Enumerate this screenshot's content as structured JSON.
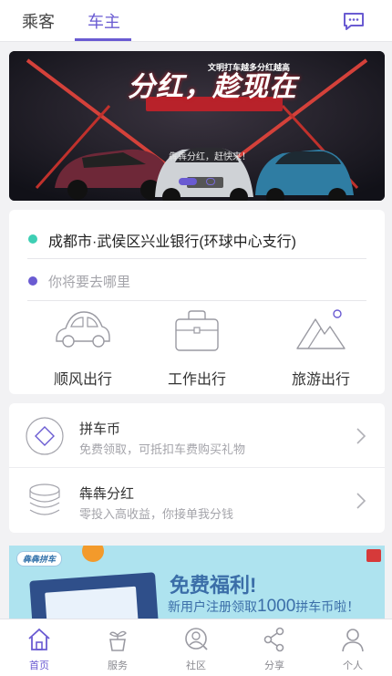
{
  "header": {
    "tabs": [
      {
        "label": "乘客",
        "active": false
      },
      {
        "label": "车主",
        "active": true
      }
    ],
    "message_icon": "chat-bubble-icon"
  },
  "banner": {
    "title": "分红，趁现在",
    "subtitle": "文明打车越多分红越高",
    "slogan": "犇犇分红，赶快来！",
    "carousel_index": 1,
    "carousel_count": 2
  },
  "route": {
    "from": "成都市·武侯区兴业银行(环球中心支行)",
    "to_placeholder": "你将要去哪里",
    "from_dot_color": "#3ecfb4",
    "to_dot_color": "#6a5bd2",
    "trip_types": [
      {
        "label": "顺风出行",
        "icon": "car-icon"
      },
      {
        "label": "工作出行",
        "icon": "briefcase-icon"
      },
      {
        "label": "旅游出行",
        "icon": "mountain-icon"
      }
    ]
  },
  "menu": [
    {
      "title": "拼车币",
      "subtitle": "免费领取，可抵扣车费购买礼物",
      "icon": "coin-diamond-icon"
    },
    {
      "title": "犇犇分红",
      "subtitle": "零投入高收益，你接单我分钱",
      "icon": "coin-stack-icon"
    }
  ],
  "promo": {
    "logo": "犇犇拼车",
    "title": "免费福利!",
    "sub_prefix": "新用户注册领取",
    "sub_amount": "1000",
    "sub_suffix": "拼车币啦！"
  },
  "bottom_nav": [
    {
      "label": "首页",
      "icon": "home-icon",
      "active": true
    },
    {
      "label": "服务",
      "icon": "plant-pot-icon",
      "active": false
    },
    {
      "label": "社区",
      "icon": "community-search-icon",
      "active": false
    },
    {
      "label": "分享",
      "icon": "share-icon",
      "active": false
    },
    {
      "label": "个人",
      "icon": "person-icon",
      "active": false
    }
  ],
  "colors": {
    "accent": "#6a5bd2",
    "icon_gray": "#9a9aa2"
  }
}
